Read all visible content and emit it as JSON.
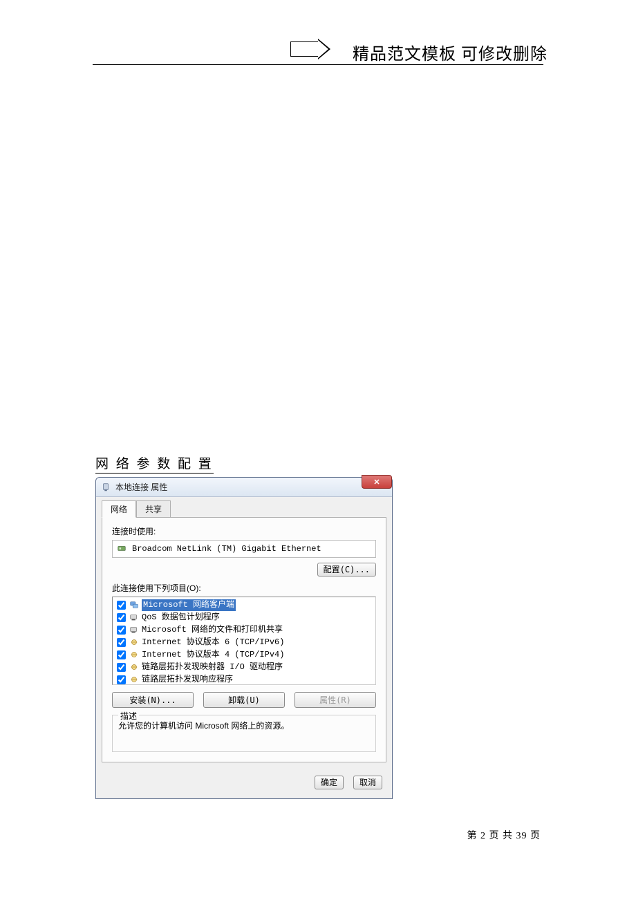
{
  "header": {
    "banner_text": "精品范文模板  可修改删除"
  },
  "section_title": "网 络 参 数 配 置",
  "dialog": {
    "title": "本地连接 属性",
    "close_glyph": "✕",
    "tabs": {
      "network": "网络",
      "sharing": "共享"
    },
    "connect_using_label": "连接时使用:",
    "adapter_name": "Broadcom NetLink (TM) Gigabit Ethernet",
    "configure_btn": "配置(C)...",
    "items_label": "此连接使用下列项目(O):",
    "items": [
      {
        "label": "Microsoft 网络客户端",
        "checked": true,
        "selected": true,
        "icon": "client"
      },
      {
        "label": "QoS 数据包计划程序",
        "checked": true,
        "selected": false,
        "icon": "service"
      },
      {
        "label": "Microsoft 网络的文件和打印机共享",
        "checked": true,
        "selected": false,
        "icon": "service"
      },
      {
        "label": "Internet 协议版本 6 (TCP/IPv6)",
        "checked": true,
        "selected": false,
        "icon": "protocol"
      },
      {
        "label": "Internet 协议版本 4 (TCP/IPv4)",
        "checked": true,
        "selected": false,
        "icon": "protocol"
      },
      {
        "label": "链路层拓扑发现映射器 I/O 驱动程序",
        "checked": true,
        "selected": false,
        "icon": "protocol"
      },
      {
        "label": "链路层拓扑发现响应程序",
        "checked": true,
        "selected": false,
        "icon": "protocol"
      }
    ],
    "install_btn": "安装(N)...",
    "uninstall_btn": "卸载(U)",
    "properties_btn": "属性(R)",
    "description_label": "描述",
    "description_text": "允许您的计算机访问 Microsoft 网络上的资源。",
    "ok_btn": "确定",
    "cancel_btn": "取消"
  },
  "footer": {
    "page_text": "第 2 页 共 39 页"
  }
}
